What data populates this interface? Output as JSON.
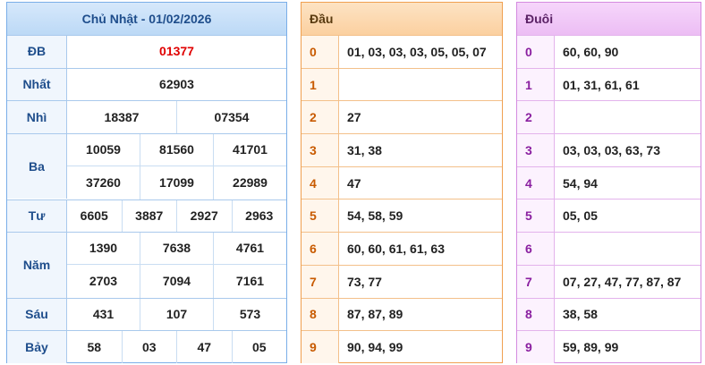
{
  "results": {
    "title": "Chủ Nhật - 01/02/2026",
    "rows": [
      {
        "label": "ĐB",
        "lines": [
          [
            "01377"
          ]
        ],
        "highlight": true
      },
      {
        "label": "Nhất",
        "lines": [
          [
            "62903"
          ]
        ]
      },
      {
        "label": "Nhì",
        "lines": [
          [
            "18387",
            "07354"
          ]
        ]
      },
      {
        "label": "Ba",
        "lines": [
          [
            "10059",
            "81560",
            "41701"
          ],
          [
            "37260",
            "17099",
            "22989"
          ]
        ]
      },
      {
        "label": "Tư",
        "lines": [
          [
            "6605",
            "3887",
            "2927",
            "2963"
          ]
        ]
      },
      {
        "label": "Năm",
        "lines": [
          [
            "1390",
            "7638",
            "4761"
          ],
          [
            "2703",
            "7094",
            "7161"
          ]
        ]
      },
      {
        "label": "Sáu",
        "lines": [
          [
            "431",
            "107",
            "573"
          ]
        ]
      },
      {
        "label": "Bảy",
        "lines": [
          [
            "58",
            "03",
            "47",
            "05"
          ]
        ]
      }
    ]
  },
  "dau": {
    "header": "Đầu",
    "rows": [
      {
        "key": "0",
        "value": "01, 03, 03, 03, 05, 05, 07"
      },
      {
        "key": "1",
        "value": ""
      },
      {
        "key": "2",
        "value": "27"
      },
      {
        "key": "3",
        "value": "31, 38"
      },
      {
        "key": "4",
        "value": "47"
      },
      {
        "key": "5",
        "value": "54, 58, 59"
      },
      {
        "key": "6",
        "value": "60, 60, 61, 61, 63"
      },
      {
        "key": "7",
        "value": "73, 77"
      },
      {
        "key": "8",
        "value": "87, 87, 89"
      },
      {
        "key": "9",
        "value": "90, 94, 99"
      }
    ]
  },
  "duoi": {
    "header": "Đuôi",
    "rows": [
      {
        "key": "0",
        "value": "60, 60, 90"
      },
      {
        "key": "1",
        "value": "01, 31, 61, 61"
      },
      {
        "key": "2",
        "value": ""
      },
      {
        "key": "3",
        "value": "03, 03, 03, 63, 73"
      },
      {
        "key": "4",
        "value": "54, 94"
      },
      {
        "key": "5",
        "value": "05, 05"
      },
      {
        "key": "6",
        "value": ""
      },
      {
        "key": "7",
        "value": "07, 27, 47, 77, 87, 87"
      },
      {
        "key": "8",
        "value": "38, 58"
      },
      {
        "key": "9",
        "value": "59, 89, 99"
      }
    ]
  },
  "colors": {
    "results_border": "#7aaee8",
    "dau_border": "#f0a050",
    "duoi_border": "#d48be0",
    "special_prize": "#e00000"
  }
}
